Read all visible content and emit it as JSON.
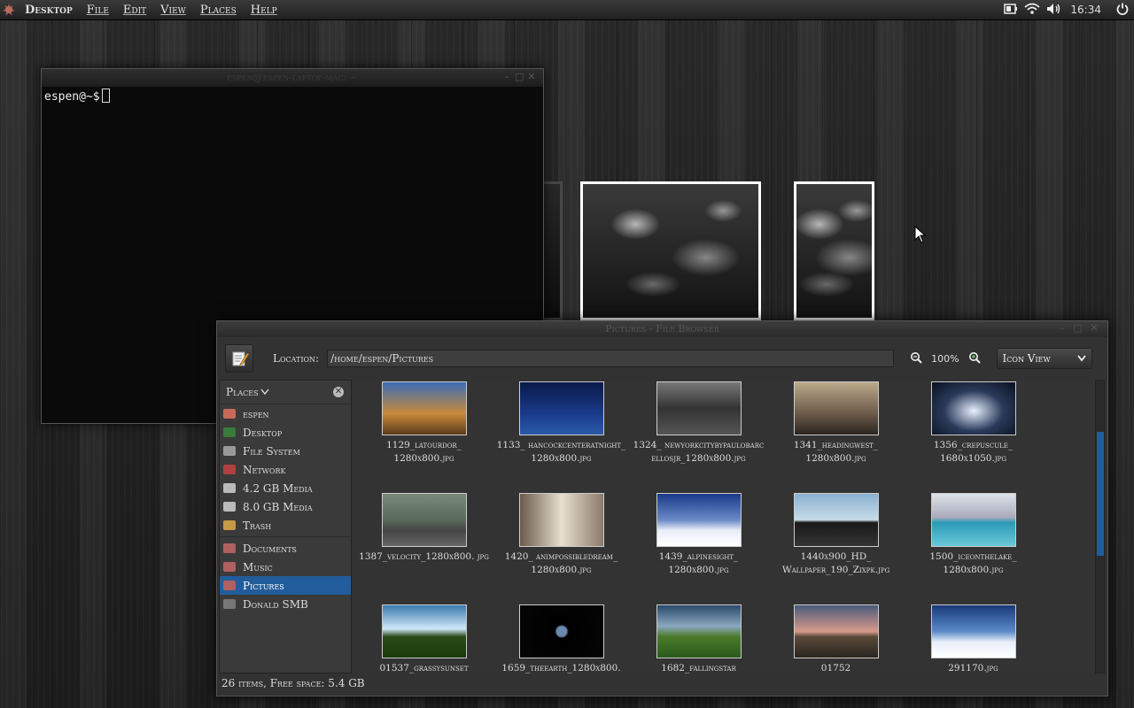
{
  "panel": {
    "app_label": "Desktop",
    "menus": [
      "File",
      "Edit",
      "View",
      "Places",
      "Help"
    ],
    "clock": "16:34"
  },
  "terminal": {
    "title": "espen@espen-laptop-mac: ~",
    "prompt": "espen@~$"
  },
  "file_browser": {
    "title": "Pictures - File Browser",
    "location_label": "Location:",
    "location_value": "/home/espen/Pictures",
    "zoom_level": "100%",
    "view_mode": "Icon View",
    "sidebar_header": "Places",
    "places": [
      {
        "label": "espen",
        "color": "#c76a5a"
      },
      {
        "label": "Desktop",
        "color": "#3a7a3a"
      },
      {
        "label": "File System",
        "color": "#999999"
      },
      {
        "label": "Network",
        "color": "#b04040"
      },
      {
        "label": "4.2 GB Media",
        "color": "#bbbbbb"
      },
      {
        "label": "8.0 GB Media",
        "color": "#bbbbbb"
      },
      {
        "label": "Trash",
        "color": "#c79a4a"
      }
    ],
    "bookmarks": [
      {
        "label": "Documents",
        "color": "#b06060"
      },
      {
        "label": "Music",
        "color": "#b06060"
      },
      {
        "label": "Pictures",
        "color": "#b06060"
      },
      {
        "label": "Donald SMB",
        "color": "#777777"
      }
    ],
    "selected_bookmark": 2,
    "files": [
      {
        "name": "1129_latourdor_ 1280x800.jpg",
        "bg": "linear-gradient(#3b6db8,#c98a3a 60%,#5a3a1a)"
      },
      {
        "name": "1133_ hancockcenteratnight_ 1280x800.jpg",
        "bg": "linear-gradient(#0a1a4a,#1a3a8a 60%,#2a5aaa)"
      },
      {
        "name": "1324_ newyorkcitybypaulobarc ellosjr_1280x800.jpg",
        "bg": "linear-gradient(#777,#333 50%,#555)"
      },
      {
        "name": "1341_headingwest_ 1280x800.jpg",
        "bg": "linear-gradient(#bba98a,#6b5a4a 60%,#2a2520)"
      },
      {
        "name": "1356_crepuscule_ 1680x1050.jpg",
        "bg": "radial-gradient(ellipse at 50% 55%,#e8f0ff,#2a3a5a 50%,#0a1020)"
      },
      {
        "name": "1387_velocity_1280x800. jpg",
        "bg": "linear-gradient(#7a8a7a,#5a6a5a 50%,#444 70%,#666)"
      },
      {
        "name": "1420_ animpossibledream_ 1280x800.jpg",
        "bg": "linear-gradient(90deg,#6a5a4a,#e8e0d0 50%,#8a7a6a)"
      },
      {
        "name": "1439_alpinesight_ 1280x800.jpg",
        "bg": "linear-gradient(#1a3a8a,#6a8ac8 50%,#e8eef8 70%,#fff)"
      },
      {
        "name": "1440x900_HD_ Wallpaper_190_Zixpk.jpg",
        "bg": "linear-gradient(#8ab0d0,#c8dcea 50%,#1a1a1a 55%,#333)"
      },
      {
        "name": "1500_iceonthelake_ 1280x800.jpg",
        "bg": "linear-gradient(#dde4ea,#aab 45%,#2a9ab8 55%,#6ac8d8)"
      },
      {
        "name": "01537_grassysunset",
        "bg": "linear-gradient(#3a7ab0,#cfe8f8 45%,#2a4a1a 60%,#1a3a0a)"
      },
      {
        "name": "1659_theearth_1280x800.",
        "bg": "radial-gradient(circle at 50% 50%,#6a8ab0 0 10%,#000 14%,#050505)"
      },
      {
        "name": "1682_fallingstar",
        "bg": "linear-gradient(#2a4a6a,#8aa8c0 40%,#4a7a2a 60%,#2a5a1a)"
      },
      {
        "name": "01752",
        "bg": "linear-gradient(#4a5a7a,#d89a8a 50%,#5a4a3a 60%,#2a2520)"
      },
      {
        "name": "291170.jpg",
        "bg": "linear-gradient(#1a3a7a,#5a8ac8 50%,#e8eef8 70%,#fff)"
      }
    ],
    "status": "26 items, Free space: 5.4 GB"
  }
}
